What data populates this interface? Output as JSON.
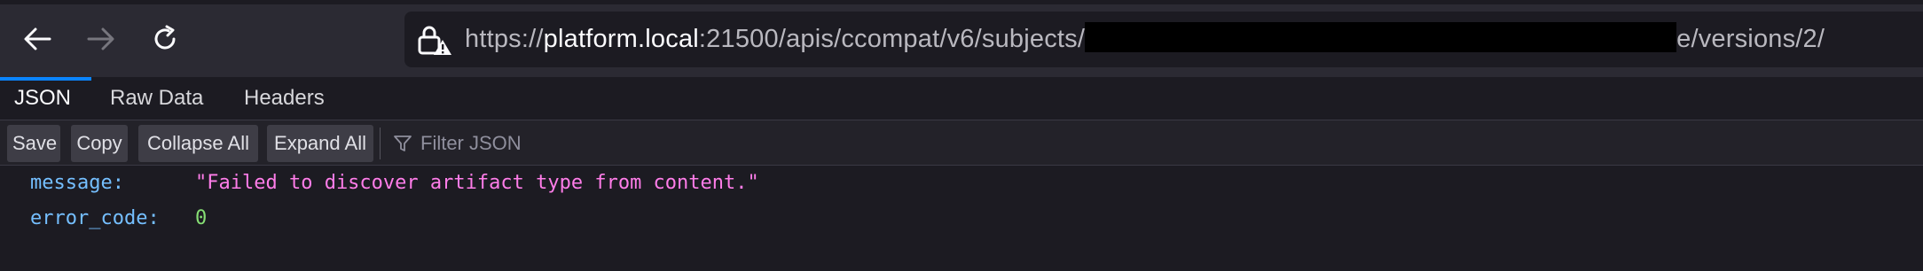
{
  "browser": {
    "url": {
      "scheme": "https://",
      "host": "platform.local",
      "path_before": ":21500/apis/ccompat/v6/subjects/",
      "path_after": "e/versions/2/"
    },
    "icons": {
      "back": "back-arrow-icon",
      "forward": "forward-arrow-icon",
      "reload": "reload-icon",
      "lock": "insecure-lock-icon"
    }
  },
  "tabs": [
    {
      "label": "JSON",
      "active": true
    },
    {
      "label": "Raw Data",
      "active": false
    },
    {
      "label": "Headers",
      "active": false
    }
  ],
  "toolbar": {
    "save_label": "Save",
    "copy_label": "Copy",
    "collapse_label": "Collapse All",
    "expand_label": "Expand All",
    "filter_placeholder": "Filter JSON"
  },
  "json": {
    "rows": [
      {
        "key": "message:",
        "value": "\"Failed to discover artifact type from content.\""
      },
      {
        "key": "error_code:",
        "value": "0"
      }
    ]
  },
  "colors": {
    "accent": "#0a84ff",
    "key": "#75bfff",
    "string": "#ff7de9",
    "number": "#86de74"
  }
}
